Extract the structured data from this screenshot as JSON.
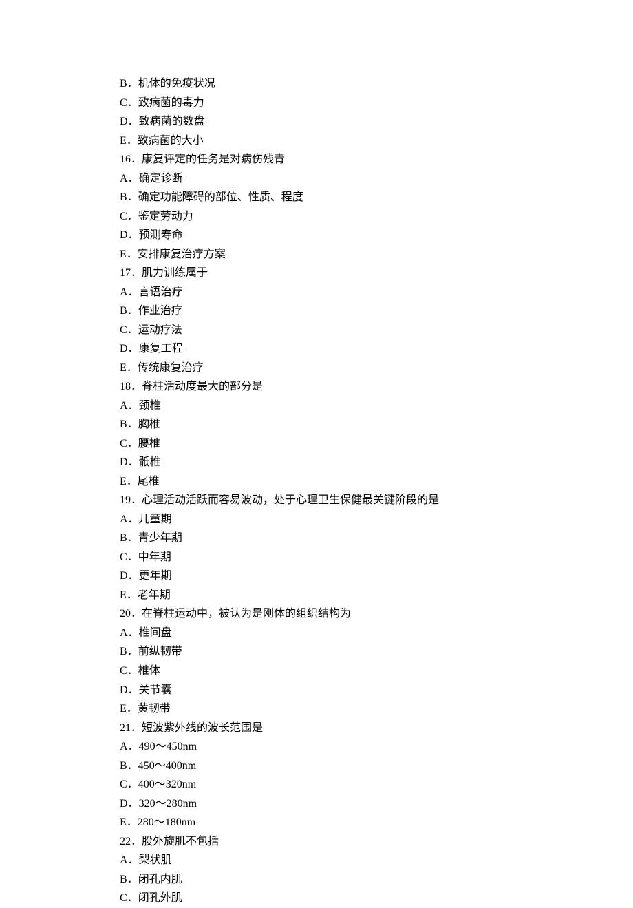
{
  "lines": [
    {
      "label": "B．",
      "text": "机体的免疫状况"
    },
    {
      "label": "C．",
      "text": "致病菌的毒力"
    },
    {
      "label": "D．",
      "text": "致病菌的数盘"
    },
    {
      "label": "E．",
      "text": "致病菌的大小"
    },
    {
      "label": "16．",
      "text": "康复评定的任务是对病伤残青"
    },
    {
      "label": "A．",
      "text": "确定诊断"
    },
    {
      "label": "B．",
      "text": "确定功能障碍的部位、性质、程度"
    },
    {
      "label": "C．",
      "text": "鉴定劳动力"
    },
    {
      "label": "D．",
      "text": "预测寿命"
    },
    {
      "label": "E．",
      "text": "安排康复治疗方案"
    },
    {
      "label": "17．",
      "text": "肌力训练属于"
    },
    {
      "label": "A．",
      "text": "言语治疗"
    },
    {
      "label": "B．",
      "text": "作业治疗"
    },
    {
      "label": "C．",
      "text": "运动疗法"
    },
    {
      "label": "D．",
      "text": "康复工程"
    },
    {
      "label": "E．",
      "text": "传统康复治疗"
    },
    {
      "label": "18．",
      "text": "脊柱活动度最大的部分是"
    },
    {
      "label": "A．",
      "text": "颈椎"
    },
    {
      "label": "B．",
      "text": "胸椎"
    },
    {
      "label": "C．",
      "text": "腰椎"
    },
    {
      "label": "D．",
      "text": "骶椎"
    },
    {
      "label": "E．",
      "text": "尾椎"
    },
    {
      "label": "19．",
      "text": "心理活动活跃而容易波动，处于心理卫生保健最关键阶段的是"
    },
    {
      "label": "A．",
      "text": "儿童期"
    },
    {
      "label": "B．",
      "text": "青少年期"
    },
    {
      "label": "C．",
      "text": "中年期"
    },
    {
      "label": "D．",
      "text": "更年期"
    },
    {
      "label": "E．",
      "text": "老年期"
    },
    {
      "label": "20．",
      "text": "在脊柱运动中，被认为是刚体的组织结构为"
    },
    {
      "label": "A．",
      "text": "椎间盘"
    },
    {
      "label": "B．",
      "text": "前纵韧带"
    },
    {
      "label": "C．",
      "text": "椎体"
    },
    {
      "label": "D．",
      "text": "关节囊"
    },
    {
      "label": "E．",
      "text": "黄韧带"
    },
    {
      "label": "21．",
      "text": "短波紫外线的波长范围是"
    },
    {
      "label": "A．",
      "text": "490～450nm"
    },
    {
      "label": "B．",
      "text": "450～400nm"
    },
    {
      "label": "C．",
      "text": "400～320nm"
    },
    {
      "label": "D．",
      "text": "320～280nm"
    },
    {
      "label": "E．",
      "text": "280～180nm"
    },
    {
      "label": "22．",
      "text": "股外旋肌不包括"
    },
    {
      "label": "A．",
      "text": "梨状肌"
    },
    {
      "label": "B．",
      "text": "闭孔内肌"
    },
    {
      "label": "C．",
      "text": "闭孔外肌"
    }
  ]
}
